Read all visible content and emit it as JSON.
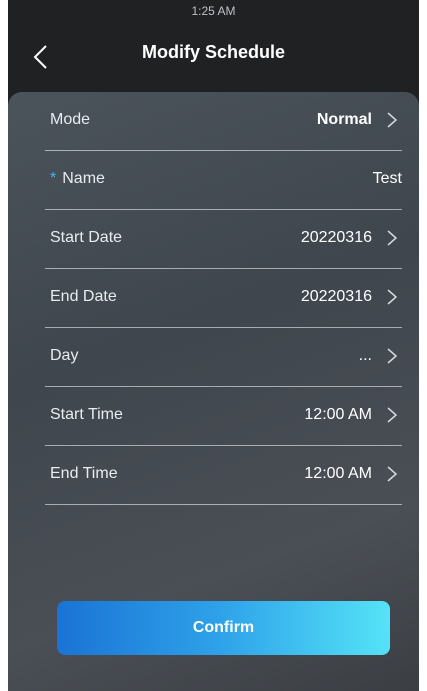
{
  "status_bar": {
    "time": "1:25 AM"
  },
  "header": {
    "title": "Modify Schedule"
  },
  "form": {
    "rows": [
      {
        "label": "Mode",
        "value": "Normal"
      },
      {
        "label": "Name",
        "value": "Test",
        "required_mark": "*"
      },
      {
        "label": "Start Date",
        "value": "20220316"
      },
      {
        "label": "End Date",
        "value": "20220316"
      },
      {
        "label": "Day",
        "value": "..."
      },
      {
        "label": "Start Time",
        "value": "12:00 AM"
      },
      {
        "label": "End Time",
        "value": "12:00 AM"
      }
    ]
  },
  "confirm_label": "Confirm",
  "colors": {
    "accent": "#39b7f0",
    "button_start": "#1a73d4",
    "button_end": "#55e3f7"
  }
}
